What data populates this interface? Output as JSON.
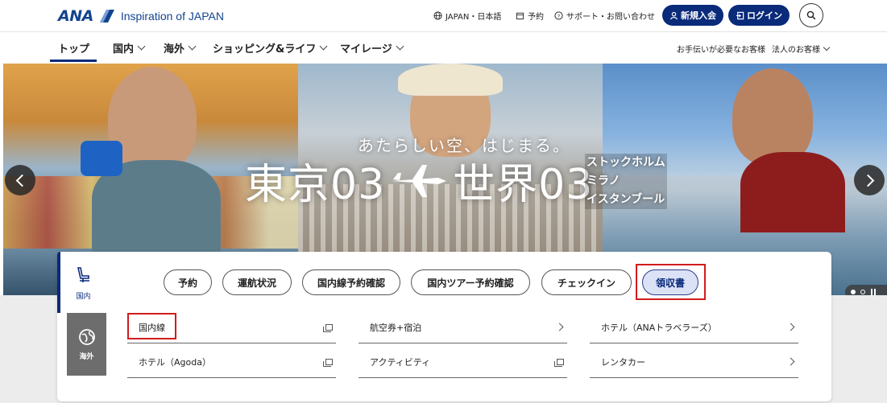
{
  "header": {
    "logo_text": "ANA",
    "tagline": "Inspiration of JAPAN",
    "language": "JAPAN・日本語",
    "reservation": "予約",
    "support": "サポート・お問い合わせ",
    "signup": "新規入会",
    "login": "ログイン"
  },
  "nav": {
    "items": [
      "トップ",
      "国内",
      "海外",
      "ショッピング&ライフ",
      "マイレージ"
    ],
    "help": "お手伝いが必要なお客様",
    "corporate": "法人のお客様"
  },
  "hero": {
    "tagline": "あたらしい空、はじまる。",
    "title_left": "東京03",
    "title_right": "世界03",
    "cities": [
      "ストックホルム",
      "ミラノ",
      "イスタンブール"
    ]
  },
  "booking": {
    "tab_domestic": "国内",
    "tab_international": "海外",
    "chips": [
      "予約",
      "運航状況",
      "国内線予約確認",
      "国内ツアー予約確認",
      "チェックイン",
      "領収書"
    ],
    "active_chip": "領収書",
    "links": [
      {
        "label": "国内線",
        "type": "external"
      },
      {
        "label": "航空券+宿泊",
        "type": "arrow"
      },
      {
        "label": "ホテル（ANAトラベラーズ）",
        "type": "arrow"
      },
      {
        "label": "ホテル（Agoda）",
        "type": "external"
      },
      {
        "label": "アクティビティ",
        "type": "external"
      },
      {
        "label": "レンタカー",
        "type": "arrow"
      }
    ]
  },
  "colors": {
    "brand_navy": "#0a2a7a",
    "logo_blue": "#13448f",
    "highlight_red": "#d21b1b",
    "active_chip_bg": "#dbe2f5"
  }
}
